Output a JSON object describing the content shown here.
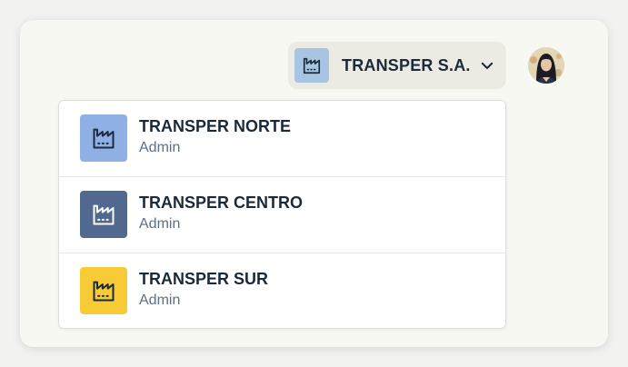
{
  "header": {
    "org_switcher": {
      "name": "TRANSPER S.A.",
      "icon": "factory-icon",
      "icon_bg": "#a7c4e3"
    },
    "avatar": {
      "icon": "user-avatar"
    }
  },
  "dropdown": {
    "items": [
      {
        "title": "TRANSPER NORTE",
        "role": "Admin",
        "icon": "factory-icon",
        "icon_bg": "#8fb0e5"
      },
      {
        "title": "TRANSPER CENTRO",
        "role": "Admin",
        "icon": "factory-icon",
        "icon_bg": "#51698f"
      },
      {
        "title": "TRANSPER SUR",
        "role": "Admin",
        "icon": "factory-icon",
        "icon_bg": "#f6cb35"
      }
    ]
  },
  "colors": {
    "text_primary": "#1a2a3a",
    "text_secondary": "#5b6f86",
    "switcher_bg": "#ebeae3"
  }
}
